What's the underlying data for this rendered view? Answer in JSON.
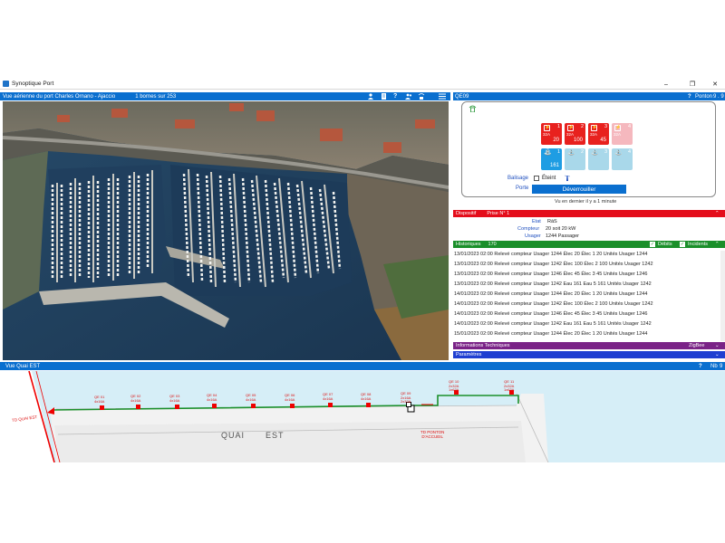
{
  "window": {
    "title": "Synoptique Port",
    "min": "–",
    "max": "❐",
    "close": "✕"
  },
  "aerial": {
    "title": "Vue aérienne du port  Charles Ornano - Ajaccio",
    "count": "1  bornes sur  253"
  },
  "borne": {
    "id": "QE09",
    "help": "?",
    "ponton_label": "Ponton",
    "ponton_value": "9 . 9",
    "outlets": [
      {
        "num": "1",
        "amp": "32A",
        "value": "20",
        "color": "#e8211e"
      },
      {
        "num": "2",
        "amp": "32A",
        "value": "100",
        "color": "#e8211e"
      },
      {
        "num": "3",
        "amp": "32A",
        "value": "45",
        "color": "#e8211e"
      },
      {
        "num": "4",
        "amp": "32A",
        "value": "",
        "color": "#f5b8be"
      }
    ],
    "water": [
      {
        "num": "1",
        "value": "161",
        "color": "#1e9de3"
      },
      {
        "num": "2",
        "value": "",
        "color": "#a9d8ea"
      },
      {
        "num": "3",
        "value": "",
        "color": "#a9d8ea"
      },
      {
        "num": "4",
        "value": "",
        "color": "#a9d8ea"
      }
    ],
    "balisage_label": "Balisage",
    "balisage_state": "Éteint",
    "porte_label": "Porte",
    "unlock_button": "Déverrouiller",
    "last_seen": "Vu en dernier il y a 1 minute"
  },
  "dispositif": {
    "title": "Dispositif",
    "prise": "Prise N°  1",
    "etat_label": "Etat",
    "etat_value": "RàS",
    "compteur_label": "Compteur",
    "compteur_value": "20  soit  20 kW",
    "usager_label": "Usager",
    "usager_value": "1244 Passager"
  },
  "historiques": {
    "title": "Historiques",
    "count": "170",
    "debits": "Débits",
    "incidents": "Incidents",
    "rows": [
      "13/01/2023 02:00 Relevé compteur Usager 1244  Élec 20 Élec 1  20 Unités Usager 1244",
      "13/01/2023 02:00 Relevé compteur Usager 1242  Élec 100 Élec 2  100 Unités Usager 1242",
      "13/01/2023 02:00 Relevé compteur Usager 1246  Élec 45 Élec 3  45 Unités Usager 1246",
      "13/01/2023 02:00 Relevé compteur Usager 1242  Eau 161 Eau 5  161 Unités Usager 1242",
      "14/01/2023 02:00 Relevé compteur Usager 1244  Élec 20 Élec 1  20 Unités Usager 1244",
      "14/01/2023 02:00 Relevé compteur Usager 1242  Élec 100 Élec 2  100 Unités Usager 1242",
      "14/01/2023 02:00 Relevé compteur Usager 1246  Élec 45 Élec 3  45 Unités Usager 1246",
      "14/01/2023 02:00 Relevé compteur Usager 1242  Eau 161 Eau 5  161 Unités Usager 1242",
      "15/01/2023 02:00 Relevé compteur Usager 1244  Élec 20 Élec 1  20 Unités Usager 1244"
    ]
  },
  "infos": {
    "title": "Informations Techniques",
    "badge": "ZigBee"
  },
  "params": {
    "title": "Paramètres"
  },
  "quai": {
    "title": "Vue  Quai EST",
    "help": "?",
    "nb_label": "Nb",
    "nb_value": "9",
    "quai_word": "QUAI",
    "est_word": "EST",
    "td_quai": "TD QUAI EST",
    "td_ponton": "TD PONTON\nD'ACCUEIL",
    "bornes": [
      {
        "name": "QE 01",
        "spec": "4x16A"
      },
      {
        "name": "QE 02",
        "spec": "4x16A"
      },
      {
        "name": "QE 03",
        "spec": "4x16A"
      },
      {
        "name": "QE 04",
        "spec": "4x16A"
      },
      {
        "name": "QE 05",
        "spec": "4x16A"
      },
      {
        "name": "QE 06",
        "spec": "4x16A"
      },
      {
        "name": "QE 07",
        "spec": "4x16A"
      },
      {
        "name": "QE 08",
        "spec": "4x16A"
      },
      {
        "name": "QE 09",
        "spec": "2x16A\n2x32A"
      },
      {
        "name": "QE 10",
        "spec": "2x32A\n1x63A"
      },
      {
        "name": "QE 11",
        "spec": "2x32A\n1x63A"
      }
    ]
  },
  "colors": {
    "titlebar_blue": "#0a6fcf",
    "dispositif_red": "#e40d1b",
    "historiques_green": "#1a8f2a",
    "infos_purple": "#7a2387",
    "params_blue": "#1f3fd1"
  }
}
